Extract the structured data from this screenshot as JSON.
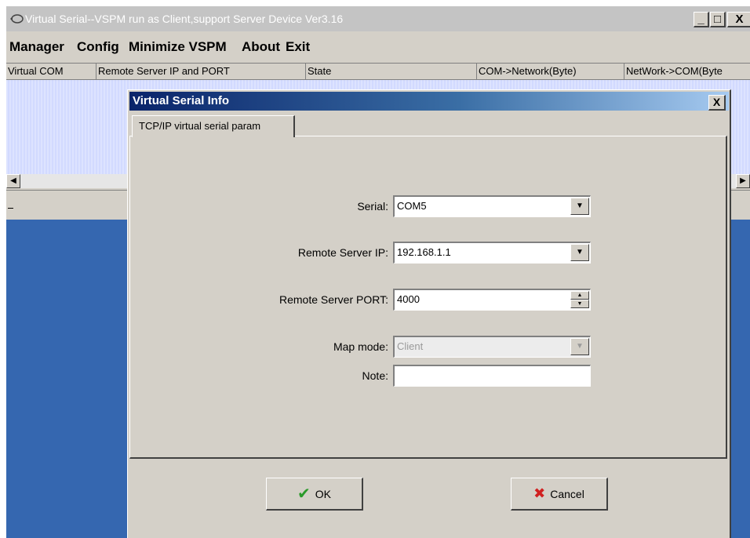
{
  "window": {
    "title": "Virtual Serial--VSPM run as Client,support Server Device  Ver3.16",
    "min_glyph": "_",
    "max_glyph": "□",
    "close_glyph": "X"
  },
  "menu": {
    "items": [
      "Manager",
      "Config",
      "Minimize VSPM",
      "About",
      "Exit"
    ]
  },
  "list": {
    "columns": [
      "Virtual COM",
      "Remote Server IP and PORT",
      "State",
      "COM->Network(Byte)",
      "NetWork->COM(Byte"
    ]
  },
  "dialog": {
    "title": "Virtual Serial Info",
    "close_glyph": "X",
    "tab_label": "TCP/IP virtual serial param",
    "fields": {
      "serial": {
        "label": "Serial:",
        "value": "COM5"
      },
      "remote_ip": {
        "label": "Remote Server IP:",
        "value": "192.168.1.1"
      },
      "remote_port": {
        "label": "Remote Server PORT:",
        "value": "4000"
      },
      "map_mode": {
        "label": "Map mode:",
        "value": "Client"
      },
      "note": {
        "label": "Note:",
        "value": ""
      }
    },
    "ok_label": "OK",
    "cancel_label": "Cancel"
  },
  "icons": {
    "ok": "check-icon",
    "cancel": "x-icon"
  },
  "colors": {
    "dialog_title_start": "#0a246a",
    "dialog_title_end": "#a6caf0",
    "desktop": "#3567b0",
    "ok_check": "#2a9a2a",
    "cancel_x": "#d02020"
  }
}
